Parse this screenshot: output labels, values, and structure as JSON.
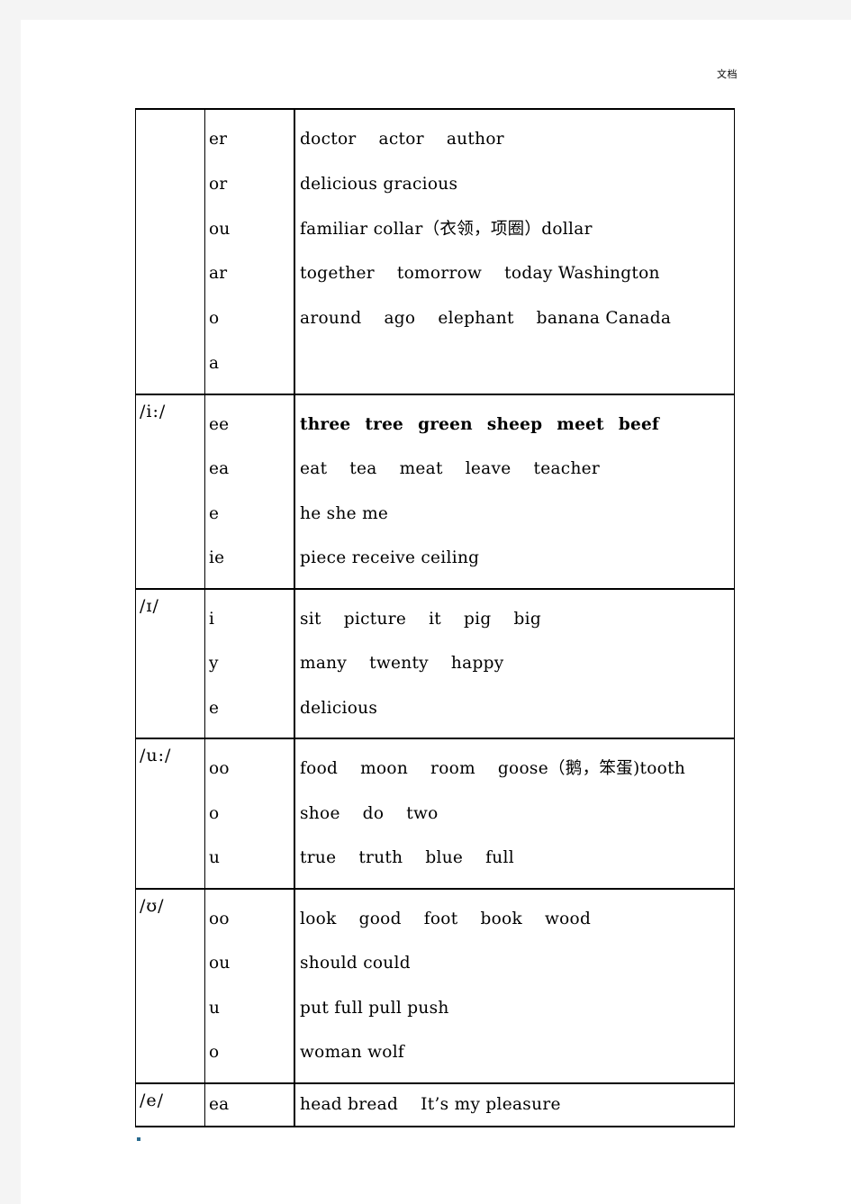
{
  "header": {
    "label": "文档"
  },
  "table": {
    "rows": [
      {
        "ipa": "",
        "spellings": [
          "er",
          "or",
          "ou",
          "ar",
          "o",
          "a"
        ],
        "words": [
          {
            "text": "doctor  actor  author",
            "bold": false
          },
          {
            "text": "delicious gracious",
            "bold": false
          },
          {
            "text": "familiar collar（衣领，项圈）dollar",
            "bold": false,
            "cjk": true
          },
          {
            "text": "together  tomorrow  today Washington",
            "bold": false
          },
          {
            "text": "around  ago  elephant  banana Canada",
            "bold": false
          },
          {
            "text": "",
            "bold": false
          }
        ]
      },
      {
        "ipa": "/i:/",
        "spellings": [
          "ee",
          "ea",
          "e",
          "ie"
        ],
        "words": [
          {
            "text": "three  tree  green  sheep  meet  beef",
            "bold": true
          },
          {
            "text": "eat  tea  meat  leave  teacher",
            "bold": false
          },
          {
            "text": "he she me",
            "bold": false
          },
          {
            "text": "piece receive ceiling",
            "bold": false
          }
        ]
      },
      {
        "ipa": "/ɪ/",
        "spellings": [
          "i",
          "y",
          "e"
        ],
        "words": [
          {
            "text": "sit  picture  it  pig  big",
            "bold": false
          },
          {
            "text": "many  twenty  happy",
            "bold": false
          },
          {
            "text": "delicious",
            "bold": false
          }
        ]
      },
      {
        "ipa": "/u:/",
        "spellings": [
          "oo",
          "o",
          "u"
        ],
        "words": [
          {
            "text": "food  moon  room  goose（鹅，笨蛋)tooth",
            "bold": false,
            "cjk": true
          },
          {
            "text": "shoe  do  two",
            "bold": false
          },
          {
            "text": "true  truth  blue  full",
            "bold": false
          }
        ]
      },
      {
        "ipa": "/ʊ/",
        "spellings": [
          "oo",
          "ou",
          "u",
          "o"
        ],
        "words": [
          {
            "text": "look  good  foot  book  wood",
            "bold": false
          },
          {
            "text": "should could",
            "bold": false
          },
          {
            "text": "put full pull push",
            "bold": false
          },
          {
            "text": "woman wolf",
            "bold": false
          }
        ]
      },
      {
        "ipa": "/e/",
        "spellings": [
          "ea"
        ],
        "words": [
          {
            "text": "head bread   It’s my pleasure",
            "bold": false
          }
        ]
      }
    ]
  },
  "colors": {
    "page_background": "#ffffff",
    "chrome_gray": "#f4f4f4",
    "border": "#000000",
    "text": "#000000",
    "speck": "#2a6b8f"
  }
}
